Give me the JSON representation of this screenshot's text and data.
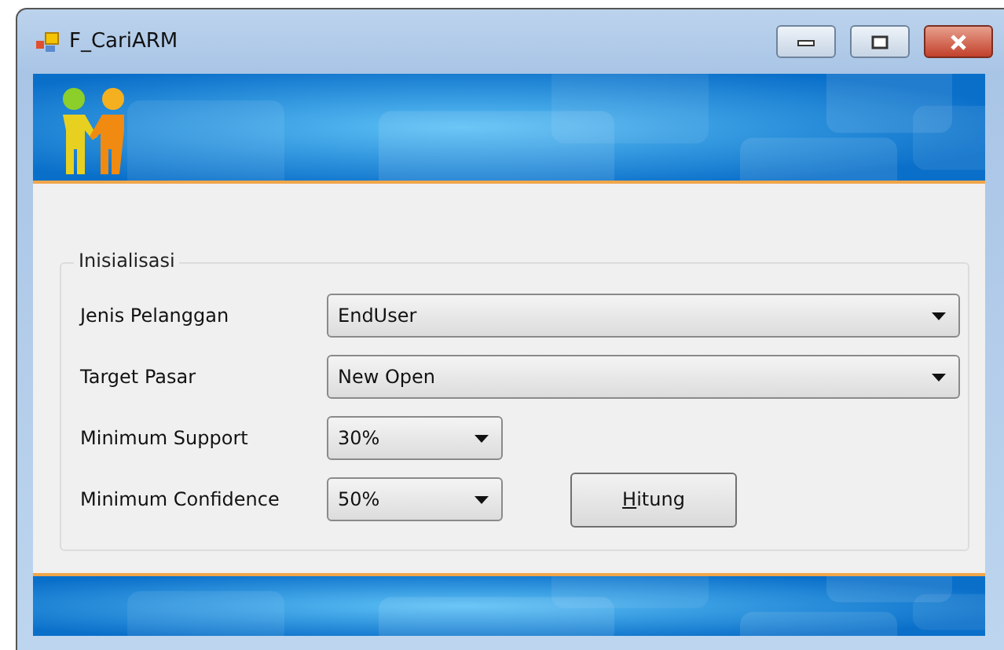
{
  "window": {
    "title": "F_CariARM"
  },
  "group": {
    "legend": "Inisialisasi",
    "fields": [
      {
        "label": "Jenis Pelanggan",
        "value": "EndUser",
        "kind": "wide"
      },
      {
        "label": "Target Pasar",
        "value": "New Open",
        "kind": "wide"
      },
      {
        "label": "Minimum Support",
        "value": "30%",
        "kind": "narrow"
      },
      {
        "label": "Minimum Confidence",
        "value": "50%",
        "kind": "narrow"
      }
    ]
  },
  "button": {
    "label": "Hitung"
  }
}
